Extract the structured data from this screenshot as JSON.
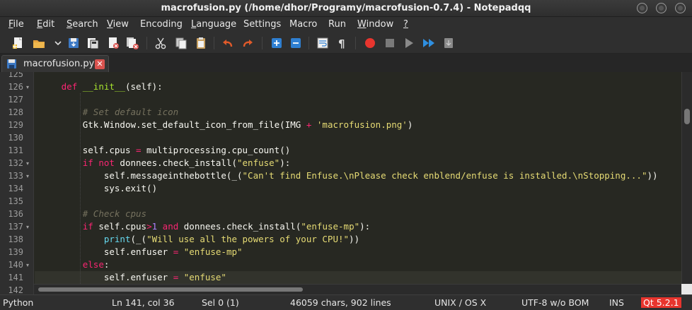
{
  "window": {
    "title": "macrofusion.py (/home/dhor/Programy/macrofusion-0.7.4) - Notepadqq"
  },
  "menu": [
    {
      "label": "File",
      "mnemonic": "F",
      "rest": "ile"
    },
    {
      "label": "Edit",
      "mnemonic": "E",
      "rest": "dit"
    },
    {
      "label": "Search",
      "mnemonic": "S",
      "rest": "earch"
    },
    {
      "label": "View",
      "mnemonic": "V",
      "rest": "iew"
    },
    {
      "label": "Encoding",
      "mnemonic": "",
      "rest": "Encoding"
    },
    {
      "label": "Language",
      "mnemonic": "L",
      "rest": "anguage"
    },
    {
      "label": "Settings",
      "mnemonic": "",
      "rest": "Settings"
    },
    {
      "label": "Macro",
      "mnemonic": "",
      "rest": "Macro"
    },
    {
      "label": "Run",
      "mnemonic": "",
      "rest": "Run"
    },
    {
      "label": "Window",
      "mnemonic": "W",
      "rest": "indow"
    },
    {
      "label": "?",
      "mnemonic": "?",
      "rest": ""
    }
  ],
  "toolbar": {
    "icons": [
      "new-file-icon",
      "open-file-icon",
      "dropdown-arrow-icon",
      "save-icon",
      "save-all-icon",
      "close-file-icon",
      "close-all-icon",
      "cut-icon",
      "copy-icon",
      "paste-icon",
      "undo-icon",
      "redo-icon",
      "zoom-in-icon",
      "zoom-out-icon",
      "word-wrap-icon",
      "show-all-chars-icon",
      "record-macro-icon",
      "stop-macro-icon",
      "play-macro-icon",
      "run-macro-multiple-icon",
      "save-macro-icon"
    ]
  },
  "tab": {
    "label": "macrofusion.py",
    "close_symbol": "✕"
  },
  "editor": {
    "line_numbers": [
      "125",
      "126",
      "127",
      "128",
      "129",
      "130",
      "131",
      "132",
      "133",
      "134",
      "135",
      "136",
      "137",
      "138",
      "139",
      "140",
      "141",
      "142"
    ],
    "fold_markers": {
      "126": "▾",
      "132": "▾",
      "133": "▾",
      "137": "▾",
      "140": "▾"
    },
    "current_line": "141",
    "lines": [
      {
        "n": "125",
        "tokens": []
      },
      {
        "n": "126",
        "tokens": [
          [
            "pl",
            "    "
          ],
          [
            "kw",
            "def"
          ],
          [
            "pl",
            " "
          ],
          [
            "fn",
            "__init__"
          ],
          [
            "pl",
            "(self):"
          ]
        ]
      },
      {
        "n": "127",
        "tokens": []
      },
      {
        "n": "128",
        "tokens": [
          [
            "pl",
            "        "
          ],
          [
            "cm",
            "# Set default icon"
          ]
        ]
      },
      {
        "n": "129",
        "tokens": [
          [
            "pl",
            "        Gtk.Window.set_default_icon_from_file(IMG "
          ],
          [
            "op",
            "+"
          ],
          [
            "pl",
            " "
          ],
          [
            "str",
            "'macrofusion.png'"
          ],
          [
            "pl",
            ")"
          ]
        ]
      },
      {
        "n": "130",
        "tokens": []
      },
      {
        "n": "131",
        "tokens": [
          [
            "pl",
            "        self.cpus "
          ],
          [
            "op",
            "="
          ],
          [
            "pl",
            " multiprocessing.cpu_count()"
          ]
        ]
      },
      {
        "n": "132",
        "tokens": [
          [
            "pl",
            "        "
          ],
          [
            "kw",
            "if not"
          ],
          [
            "pl",
            " donnees.check_install("
          ],
          [
            "str",
            "\"enfuse\""
          ],
          [
            "pl",
            "):"
          ]
        ]
      },
      {
        "n": "133",
        "tokens": [
          [
            "pl",
            "            self.messageinthebottle(_("
          ],
          [
            "str",
            "\"Can't find Enfuse.\\nPlease check enblend/enfuse is installed.\\nStopping...\""
          ],
          [
            "pl",
            "))"
          ]
        ]
      },
      {
        "n": "134",
        "tokens": [
          [
            "pl",
            "            sys.exit()"
          ]
        ]
      },
      {
        "n": "135",
        "tokens": []
      },
      {
        "n": "136",
        "tokens": [
          [
            "pl",
            "        "
          ],
          [
            "cm",
            "# Check cpus"
          ]
        ]
      },
      {
        "n": "137",
        "tokens": [
          [
            "pl",
            "        "
          ],
          [
            "kw",
            "if"
          ],
          [
            "pl",
            " self.cpus"
          ],
          [
            "op",
            ">"
          ],
          [
            "num",
            "1"
          ],
          [
            "pl",
            " "
          ],
          [
            "kw",
            "and"
          ],
          [
            "pl",
            " donnees.check_install("
          ],
          [
            "str",
            "\"enfuse-mp\""
          ],
          [
            "pl",
            "):"
          ]
        ]
      },
      {
        "n": "138",
        "tokens": [
          [
            "pl",
            "            "
          ],
          [
            "bi",
            "print"
          ],
          [
            "pl",
            "(_("
          ],
          [
            "str",
            "\"Will use all the powers of your CPU!\""
          ],
          [
            "pl",
            "))"
          ]
        ]
      },
      {
        "n": "139",
        "tokens": [
          [
            "pl",
            "            self.enfuser "
          ],
          [
            "op",
            "="
          ],
          [
            "pl",
            " "
          ],
          [
            "str",
            "\"enfuse-mp\""
          ]
        ]
      },
      {
        "n": "140",
        "tokens": [
          [
            "pl",
            "        "
          ],
          [
            "kw",
            "else"
          ],
          [
            "pl",
            ":"
          ]
        ]
      },
      {
        "n": "141",
        "tokens": [
          [
            "pl",
            "            self.enfuser "
          ],
          [
            "op",
            "="
          ],
          [
            "pl",
            " "
          ],
          [
            "str",
            "\"enfuse\""
          ]
        ]
      },
      {
        "n": "142",
        "tokens": []
      }
    ]
  },
  "status": {
    "language": "Python",
    "position": "Ln 141, col 36",
    "selection": "Sel 0 (1)",
    "size": "46059 chars, 902 lines",
    "eol": "UNIX / OS X",
    "encoding": "UTF-8 w/o BOM",
    "mode": "INS",
    "qt": "Qt 5.2.1"
  },
  "colors": {
    "editor_bg": "#272822",
    "keyword": "#f92672",
    "function": "#a6e22e",
    "string": "#e6db74",
    "comment": "#75715e",
    "number": "#ae81ff",
    "record": "#e8352e",
    "qt_badge": "#e8352e"
  }
}
